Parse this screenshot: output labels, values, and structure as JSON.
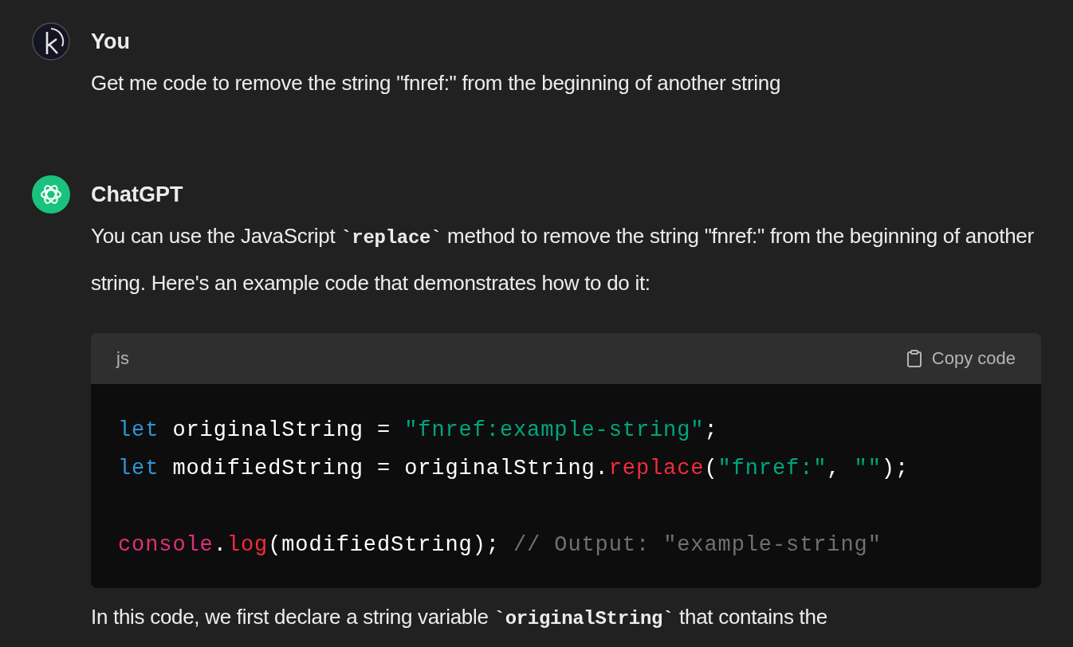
{
  "messages": [
    {
      "author": "You",
      "kind": "user",
      "paragraphs": [
        [
          {
            "kind": "text",
            "text": "Get me code to remove the string \"fnref:\" from the beginning of another string"
          }
        ]
      ]
    },
    {
      "author": "ChatGPT",
      "kind": "assistant",
      "paragraphs": [
        [
          {
            "kind": "text",
            "text": "You can use the JavaScript "
          },
          {
            "kind": "code",
            "text": "`replace`"
          },
          {
            "kind": "text",
            "text": " method to remove the string \"fnref:\" from the beginning of another string. Here's an example code that demonstrates how to do it:"
          }
        ]
      ],
      "code_block": {
        "language": "js",
        "copy_label": "Copy code",
        "lines": [
          {
            "kind": "code",
            "tokens": [
              {
                "kind": "keyword",
                "text": "let"
              },
              {
                "kind": "plain",
                "text": " originalString = "
              },
              {
                "kind": "string",
                "text": "\"fnref:example-string\""
              },
              {
                "kind": "plain",
                "text": ";"
              }
            ]
          },
          {
            "kind": "code",
            "tokens": [
              {
                "kind": "keyword",
                "text": "let"
              },
              {
                "kind": "plain",
                "text": " modifiedString = originalString."
              },
              {
                "kind": "method",
                "text": "replace"
              },
              {
                "kind": "plain",
                "text": "("
              },
              {
                "kind": "string",
                "text": "\"fnref:\""
              },
              {
                "kind": "plain",
                "text": ", "
              },
              {
                "kind": "string",
                "text": "\"\""
              },
              {
                "kind": "plain",
                "text": ");"
              }
            ]
          },
          {
            "kind": "blank"
          },
          {
            "kind": "code",
            "tokens": [
              {
                "kind": "builtin",
                "text": "console"
              },
              {
                "kind": "plain",
                "text": "."
              },
              {
                "kind": "method",
                "text": "log"
              },
              {
                "kind": "plain",
                "text": "(modifiedString); "
              },
              {
                "kind": "comment",
                "text": "// Output: \"example-string\""
              }
            ]
          }
        ]
      },
      "after": [
        [
          {
            "kind": "text",
            "text": "In this code, we first declare a string variable "
          },
          {
            "kind": "code",
            "text": "`originalString`"
          },
          {
            "kind": "text",
            "text": " that contains the"
          }
        ]
      ]
    }
  ]
}
